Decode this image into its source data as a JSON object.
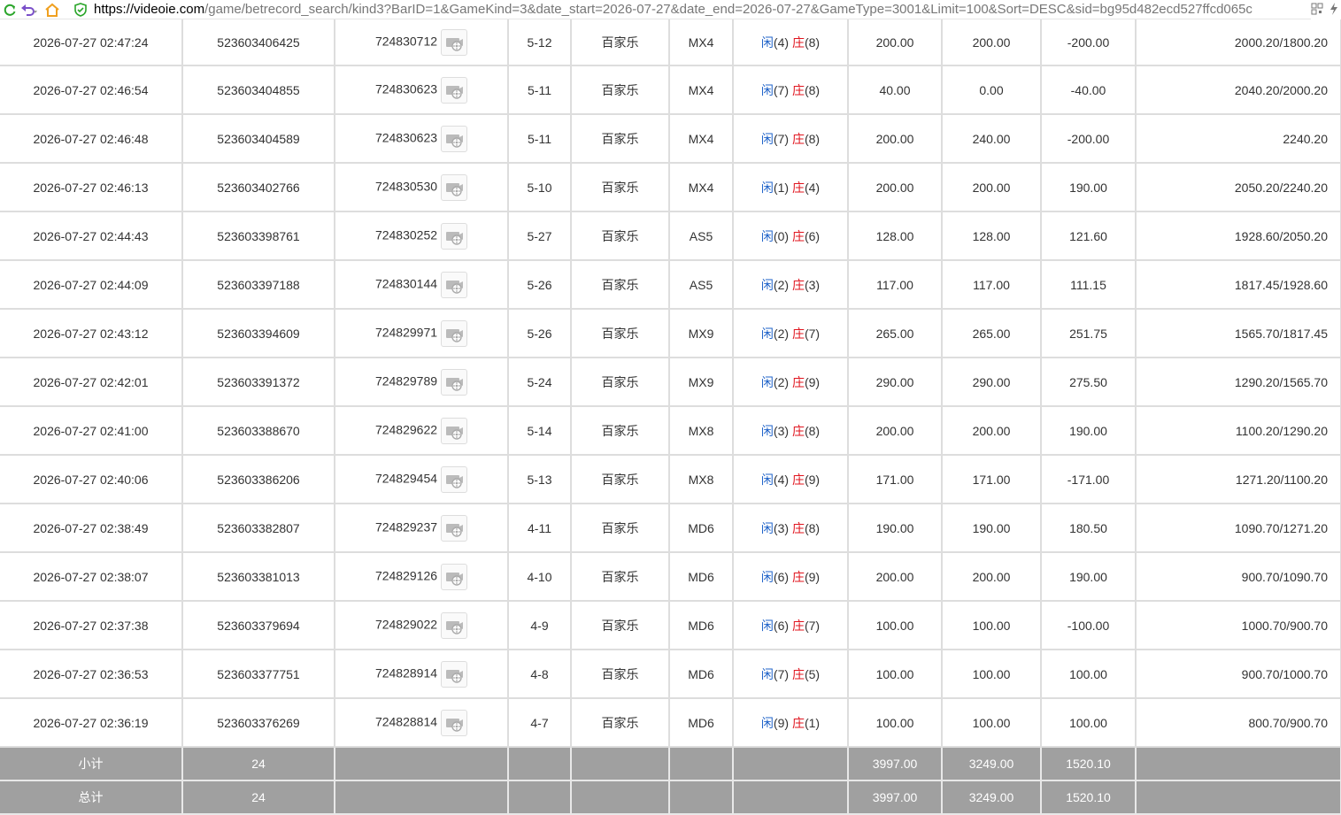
{
  "browser": {
    "url_host": "https://videoie.com",
    "url_rest": "/game/betrecord_search/kind3?BarID=1&GameKind=3&date_start=2026-07-27&date_end=2026-07-27&GameType=3001&Limit=100&Sort=DESC&sid=bg95d482ecd527ffcd065c"
  },
  "colors": {
    "accent_blue": "#1f63c9",
    "negative_red": "#e0141e",
    "summary_gray": "#a0a0a0"
  },
  "rows": [
    {
      "time": "2026-07-27 02:47:24",
      "order": "523603406425",
      "round": "724830712",
      "table": "5-12",
      "game": "百家乐",
      "room": "MX4",
      "player_label": "闲",
      "player": "(4)",
      "banker_label": "庄",
      "banker": "(8)",
      "bet": "200.00",
      "valid": "200.00",
      "win": "-200.00",
      "win_neg": true,
      "balance": "2000.20/1800.20"
    },
    {
      "time": "2026-07-27 02:46:54",
      "order": "523603404855",
      "round": "724830623",
      "table": "5-11",
      "game": "百家乐",
      "room": "MX4",
      "player_label": "闲",
      "player": "(7)",
      "banker_label": "庄",
      "banker": "(8)",
      "bet": "40.00",
      "valid": "0.00",
      "win": "-40.00",
      "win_neg": true,
      "balance": "2040.20/2000.20"
    },
    {
      "time": "2026-07-27 02:46:48",
      "order": "523603404589",
      "round": "724830623",
      "table": "5-11",
      "game": "百家乐",
      "room": "MX4",
      "player_label": "闲",
      "player": "(7)",
      "banker_label": "庄",
      "banker": "(8)",
      "bet": "200.00",
      "valid": "240.00",
      "win": "-200.00",
      "win_neg": true,
      "balance": "2240.20"
    },
    {
      "time": "2026-07-27 02:46:13",
      "order": "523603402766",
      "round": "724830530",
      "table": "5-10",
      "game": "百家乐",
      "room": "MX4",
      "player_label": "闲",
      "player": "(1)",
      "banker_label": "庄",
      "banker": "(4)",
      "bet": "200.00",
      "valid": "200.00",
      "win": "190.00",
      "win_neg": false,
      "balance": "2050.20/2240.20"
    },
    {
      "time": "2026-07-27 02:44:43",
      "order": "523603398761",
      "round": "724830252",
      "table": "5-27",
      "game": "百家乐",
      "room": "AS5",
      "player_label": "闲",
      "player": "(0)",
      "banker_label": "庄",
      "banker": "(6)",
      "bet": "128.00",
      "valid": "128.00",
      "win": "121.60",
      "win_neg": false,
      "balance": "1928.60/2050.20"
    },
    {
      "time": "2026-07-27 02:44:09",
      "order": "523603397188",
      "round": "724830144",
      "table": "5-26",
      "game": "百家乐",
      "room": "AS5",
      "player_label": "闲",
      "player": "(2)",
      "banker_label": "庄",
      "banker": "(3)",
      "bet": "117.00",
      "valid": "117.00",
      "win": "111.15",
      "win_neg": false,
      "balance": "1817.45/1928.60"
    },
    {
      "time": "2026-07-27 02:43:12",
      "order": "523603394609",
      "round": "724829971",
      "table": "5-26",
      "game": "百家乐",
      "room": "MX9",
      "player_label": "闲",
      "player": "(2)",
      "banker_label": "庄",
      "banker": "(7)",
      "bet": "265.00",
      "valid": "265.00",
      "win": "251.75",
      "win_neg": false,
      "balance": "1565.70/1817.45"
    },
    {
      "time": "2026-07-27 02:42:01",
      "order": "523603391372",
      "round": "724829789",
      "table": "5-24",
      "game": "百家乐",
      "room": "MX9",
      "player_label": "闲",
      "player": "(2)",
      "banker_label": "庄",
      "banker": "(9)",
      "bet": "290.00",
      "valid": "290.00",
      "win": "275.50",
      "win_neg": false,
      "balance": "1290.20/1565.70"
    },
    {
      "time": "2026-07-27 02:41:00",
      "order": "523603388670",
      "round": "724829622",
      "table": "5-14",
      "game": "百家乐",
      "room": "MX8",
      "player_label": "闲",
      "player": "(3)",
      "banker_label": "庄",
      "banker": "(8)",
      "bet": "200.00",
      "valid": "200.00",
      "win": "190.00",
      "win_neg": false,
      "balance": "1100.20/1290.20"
    },
    {
      "time": "2026-07-27 02:40:06",
      "order": "523603386206",
      "round": "724829454",
      "table": "5-13",
      "game": "百家乐",
      "room": "MX8",
      "player_label": "闲",
      "player": "(4)",
      "banker_label": "庄",
      "banker": "(9)",
      "bet": "171.00",
      "valid": "171.00",
      "win": "-171.00",
      "win_neg": true,
      "balance": "1271.20/1100.20"
    },
    {
      "time": "2026-07-27 02:38:49",
      "order": "523603382807",
      "round": "724829237",
      "table": "4-11",
      "game": "百家乐",
      "room": "MD6",
      "player_label": "闲",
      "player": "(3)",
      "banker_label": "庄",
      "banker": "(8)",
      "bet": "190.00",
      "valid": "190.00",
      "win": "180.50",
      "win_neg": false,
      "balance": "1090.70/1271.20"
    },
    {
      "time": "2026-07-27 02:38:07",
      "order": "523603381013",
      "round": "724829126",
      "table": "4-10",
      "game": "百家乐",
      "room": "MD6",
      "player_label": "闲",
      "player": "(6)",
      "banker_label": "庄",
      "banker": "(9)",
      "bet": "200.00",
      "valid": "200.00",
      "win": "190.00",
      "win_neg": false,
      "balance": "900.70/1090.70"
    },
    {
      "time": "2026-07-27 02:37:38",
      "order": "523603379694",
      "round": "724829022",
      "table": "4-9",
      "game": "百家乐",
      "room": "MD6",
      "player_label": "闲",
      "player": "(6)",
      "banker_label": "庄",
      "banker": "(7)",
      "bet": "100.00",
      "valid": "100.00",
      "win": "-100.00",
      "win_neg": true,
      "balance": "1000.70/900.70"
    },
    {
      "time": "2026-07-27 02:36:53",
      "order": "523603377751",
      "round": "724828914",
      "table": "4-8",
      "game": "百家乐",
      "room": "MD6",
      "player_label": "闲",
      "player": "(7)",
      "banker_label": "庄",
      "banker": "(5)",
      "bet": "100.00",
      "valid": "100.00",
      "win": "100.00",
      "win_neg": false,
      "balance": "900.70/1000.70"
    },
    {
      "time": "2026-07-27 02:36:19",
      "order": "523603376269",
      "round": "724828814",
      "table": "4-7",
      "game": "百家乐",
      "room": "MD6",
      "player_label": "闲",
      "player": "(9)",
      "banker_label": "庄",
      "banker": "(1)",
      "bet": "100.00",
      "valid": "100.00",
      "win": "100.00",
      "win_neg": false,
      "balance": "800.70/900.70"
    }
  ],
  "summary": [
    {
      "label": "小计",
      "count": "24",
      "bet": "3997.00",
      "valid": "3249.00",
      "win": "1520.10"
    },
    {
      "label": "总计",
      "count": "24",
      "bet": "3997.00",
      "valid": "3249.00",
      "win": "1520.10"
    }
  ]
}
